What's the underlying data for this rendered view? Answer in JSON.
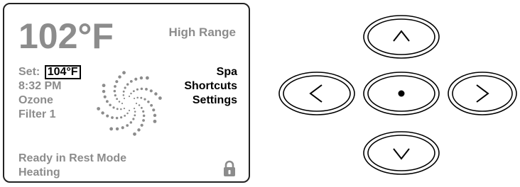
{
  "display": {
    "temperature": "102°F",
    "range": "High Range",
    "set_label": "Set:",
    "set_value": "104°F",
    "time": "8:32 PM",
    "ozone": "Ozone",
    "filter": "Filter 1",
    "status_line1": "Ready in Rest Mode",
    "status_line2": "Heating"
  },
  "menu": {
    "items": [
      {
        "label": "Spa"
      },
      {
        "label": "Shortcuts"
      },
      {
        "label": "Settings"
      }
    ]
  },
  "icons": {
    "spinner": "heater-spinner-icon",
    "lock": "lock-icon"
  },
  "buttons": [
    {
      "name": "up-button",
      "icon": "chevron-up-icon"
    },
    {
      "name": "left-button",
      "icon": "chevron-left-icon"
    },
    {
      "name": "center-button",
      "icon": "dot-icon"
    },
    {
      "name": "right-button",
      "icon": "chevron-right-icon"
    },
    {
      "name": "down-button",
      "icon": "chevron-down-icon"
    }
  ],
  "colors": {
    "screen_text": "#8c8c8c",
    "outline": "#222222"
  }
}
